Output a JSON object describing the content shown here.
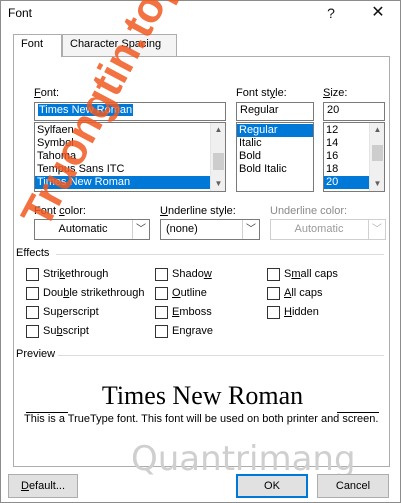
{
  "window": {
    "title": "Font",
    "help_glyph": "?",
    "close_glyph": "✕"
  },
  "tabs": [
    {
      "label": "Font",
      "active": true
    },
    {
      "label": "Character Spacing",
      "active": false
    }
  ],
  "font": {
    "label_accel": "F",
    "label_rest": "ont:",
    "value": "Times New Roman",
    "items": [
      "Sylfaen",
      "Symbol",
      "Tahoma",
      "Tempus Sans ITC",
      "Times New Roman"
    ],
    "selected_index": 4
  },
  "font_style": {
    "label_pre": "Font st",
    "label_accel": "y",
    "label_post": "le:",
    "value": "Regular",
    "items": [
      "Regular",
      "Italic",
      "Bold",
      "Bold Italic"
    ],
    "selected_index": 0
  },
  "size": {
    "label_accel": "S",
    "label_rest": "ize:",
    "value": "20",
    "items": [
      "12",
      "14",
      "16",
      "18",
      "20"
    ],
    "selected_index": 4
  },
  "font_color": {
    "label_pre": "Font ",
    "label_accel": "c",
    "label_post": "olor:",
    "value": "Automatic"
  },
  "underline_style": {
    "label_accel": "U",
    "label_rest": "nderline style:",
    "value": "(none)"
  },
  "underline_color": {
    "label": "Underline color:",
    "value": "Automatic"
  },
  "effects": {
    "heading": "Effects",
    "items": [
      {
        "pre": "Stri",
        "accel": "k",
        "post": "ethrough",
        "checked": false
      },
      {
        "pre": "Dou",
        "accel": "b",
        "post": "le strikethrough",
        "checked": false
      },
      {
        "pre": "Su",
        "accel": "p",
        "post": "erscript",
        "checked": false
      },
      {
        "pre": "Su",
        "accel": "b",
        "post": "script",
        "checked": false
      },
      {
        "pre": "Shado",
        "accel": "w",
        "post": "",
        "checked": false
      },
      {
        "pre": "",
        "accel": "O",
        "post": "utline",
        "checked": false
      },
      {
        "pre": "",
        "accel": "E",
        "post": "mboss",
        "checked": false
      },
      {
        "pre": "En",
        "accel": "g",
        "post": "rave",
        "checked": false
      },
      {
        "pre": "S",
        "accel": "m",
        "post": "all caps",
        "checked": false
      },
      {
        "pre": "",
        "accel": "A",
        "post": "ll caps",
        "checked": false
      },
      {
        "pre": "",
        "accel": "H",
        "post": "idden",
        "checked": false
      }
    ]
  },
  "preview": {
    "heading": "Preview",
    "sample": "Times New Roman",
    "note": "This is a TrueType font. This font will be used on both printer and screen."
  },
  "buttons": {
    "default_pre": "",
    "default_accel": "D",
    "default_post": "efault...",
    "ok": "OK",
    "cancel": "Cancel"
  },
  "watermarks": {
    "vertical": "Truongtin.top",
    "bottom": "Quantrimang"
  },
  "colors": {
    "selection": "#0078d7",
    "watermark": "#f05a22"
  }
}
